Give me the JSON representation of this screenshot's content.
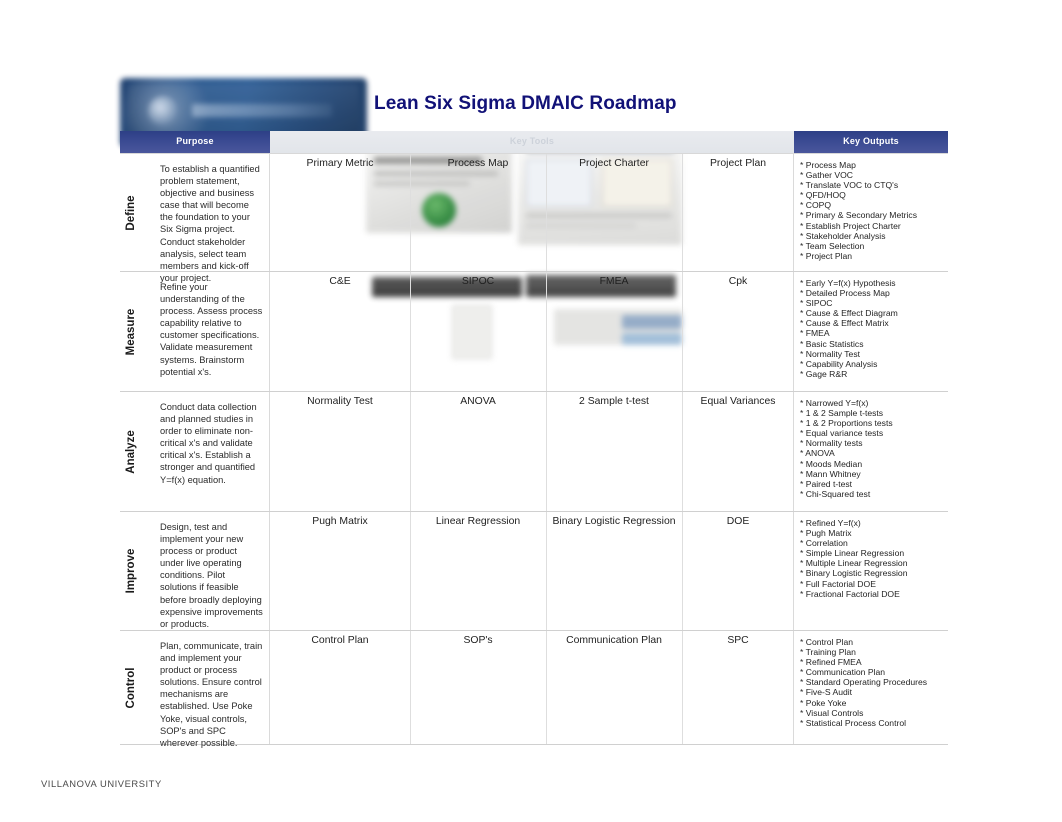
{
  "title": "Lean Six Sigma DMAIC Roadmap",
  "logo": {
    "name": "villanova-university-logo",
    "alt": "Villanova University logo banner"
  },
  "header": {
    "purpose_label": "Purpose",
    "tools_label": "Key Tools",
    "outputs_label": "Key Outputs"
  },
  "footer": {
    "text": "VILLANOVA UNIVERSITY"
  },
  "colors": {
    "band_blue": "#3a4a92",
    "title_navy": "#111177",
    "band_gray": "#e5e8ed",
    "body_text": "#2b2b2b",
    "grid_line": "#d0d0d0"
  },
  "rows": [
    {
      "phase": "Define",
      "purpose": "To establish a quantified problem statement, objective and business case that will become the foundation to your Six Sigma project. Conduct stakeholder analysis, select team members and kick-off your project.",
      "tools": [
        "Primary Metric",
        "Process Map",
        "Project Charter",
        "Project Plan"
      ],
      "outputs": [
        "* Process Map",
        "* Gather VOC",
        "* Translate VOC to CTQ's",
        "* QFD/HOQ",
        "* COPQ",
        "* Primary & Secondary Metrics",
        "* Establish Project Charter",
        "* Stakeholder Analysis",
        "* Team Selection",
        "* Project Plan"
      ]
    },
    {
      "phase": "Measure",
      "purpose": "Refine your understanding of the process. Assess process capability relative to customer specifications. Validate measurement systems. Brainstorm potential x's.",
      "tools": [
        "C&E",
        "SIPOC",
        "FMEA",
        "Cpk"
      ],
      "outputs": [
        "* Early Y=f(x) Hypothesis",
        "* Detailed Process Map",
        "* SIPOC",
        "* Cause & Effect Diagram",
        "* Cause & Effect Matrix",
        "* FMEA",
        "* Basic Statistics",
        "* Normality Test",
        "* Capability Analysis",
        "* Gage R&R"
      ]
    },
    {
      "phase": "Analyze",
      "purpose": "Conduct data collection and planned studies in order to eliminate non-critical x's and validate critical x's. Establish a stronger and quantified Y=f(x) equation.",
      "tools": [
        "Normality Test",
        "ANOVA",
        "2 Sample t-test",
        "Equal Variances"
      ],
      "outputs": [
        "* Narrowed Y=f(x)",
        "* 1 & 2 Sample t-tests",
        "* 1 & 2 Proportions tests",
        "* Equal variance tests",
        "* Normality tests",
        "* ANOVA",
        "* Moods Median",
        "* Mann Whitney",
        "* Paired t-test",
        "* Chi-Squared test"
      ]
    },
    {
      "phase": "Improve",
      "purpose": "Design, test and implement your new process or product under live operating conditions. Pilot solutions if feasible before broadly deploying expensive improvements or products.",
      "tools": [
        "Pugh Matrix",
        "Linear Regression",
        "Binary Logistic Regression",
        "DOE"
      ],
      "outputs": [
        "* Refined Y=f(x)",
        "* Pugh Matrix",
        "* Correlation",
        "* Simple Linear Regression",
        "* Multiple Linear Regression",
        "* Binary Logistic Regression",
        "* Full Factorial DOE",
        "* Fractional Factorial DOE"
      ]
    },
    {
      "phase": "Control",
      "purpose": "Plan, communicate, train and implement your product or process solutions. Ensure control mechanisms are established. Use Poke Yoke, visual controls, SOP's and SPC wherever possible.",
      "tools": [
        "Control Plan",
        "SOP's",
        "Communication Plan",
        "SPC"
      ],
      "outputs": [
        "* Control Plan",
        "* Training Plan",
        "* Refined FMEA",
        "* Communication Plan",
        "* Standard Operating Procedures",
        "* Five-S Audit",
        "* Poke Yoke",
        "* Visual Controls",
        "* Statistical Process Control"
      ]
    }
  ]
}
